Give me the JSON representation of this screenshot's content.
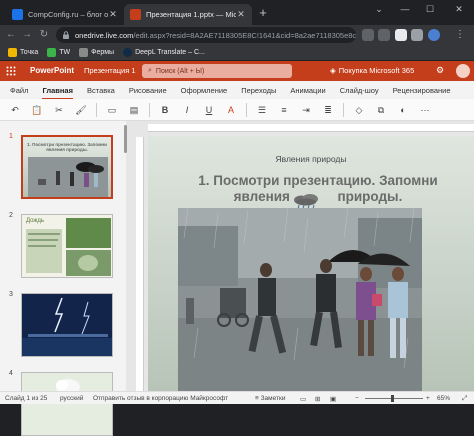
{
  "browser": {
    "tabs": [
      {
        "title": "CompConfig.ru – блог о настро",
        "active": false,
        "favicon_color": "#1a73e8"
      },
      {
        "title": "Презентация 1.pptx — Microsof",
        "active": true,
        "favicon_color": "#c43e1c"
      }
    ],
    "url_host": "onedrive.live.com",
    "url_rest": "/edit.aspx?resid=8A2AE7118305E8C!1641&cid=8a2ae7118305e8c6...",
    "bookmarks": [
      {
        "label": "Точка",
        "color": "#f2b705"
      },
      {
        "label": "TW",
        "color": "#3bb54a"
      },
      {
        "label": "Фермы",
        "color": "#8a8a8a"
      },
      {
        "label": "DeepL Translate – С...",
        "color": "#0f2b46"
      }
    ]
  },
  "ppt": {
    "app_name": "PowerPoint",
    "doc_name": "Презентация 1",
    "search_placeholder": "Поиск (Alt + Ы)",
    "ms365_label": "Покупка Microsoft 365",
    "ribbon_tabs": [
      "Файл",
      "Главная",
      "Вставка",
      "Рисование",
      "Оформление",
      "Переходы",
      "Анимации",
      "Слайд-шоу",
      "Рецензирование"
    ],
    "active_tab": "Главная",
    "brand_color": "#c43e1c"
  },
  "thumbnails": {
    "numbers": [
      "1",
      "2",
      "3",
      "4"
    ],
    "slide1_text": "1. Посмотри презентацию. Запомни явления природы.",
    "slide2_text": "Дождь"
  },
  "slide": {
    "category": "Явления природы",
    "heading_line1": "1. Посмотри презентацию. Запомни",
    "heading_line2": "явления",
    "heading_line2b": "природы."
  },
  "statusbar": {
    "slide_count": "Слайд 1 из 25",
    "language": "русский",
    "feedback": "Отправить отзыв в корпорацию Майкрософт",
    "notes": "Заметки",
    "zoom": "65%"
  }
}
